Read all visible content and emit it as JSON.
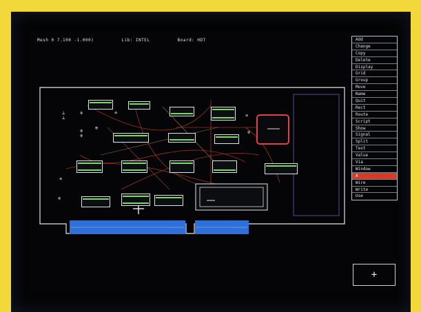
{
  "status": {
    "mesh": "Mesh 0 7.100 -1.000)",
    "lib": "Lib: INTEL",
    "board": "Board: HDT"
  },
  "menu": {
    "items": [
      {
        "label": "Add",
        "active": false
      },
      {
        "label": "Change",
        "active": false
      },
      {
        "label": "Copy",
        "active": false
      },
      {
        "label": "Delete",
        "active": false
      },
      {
        "label": "Display",
        "active": false
      },
      {
        "label": "Grid",
        "active": false
      },
      {
        "label": "Group",
        "active": false
      },
      {
        "label": "Move",
        "active": false
      },
      {
        "label": "Name",
        "active": false
      },
      {
        "label": "Quit",
        "active": false
      },
      {
        "label": "Rect",
        "active": false
      },
      {
        "label": "Route",
        "active": false
      },
      {
        "label": "Script",
        "active": false
      },
      {
        "label": "Show",
        "active": false
      },
      {
        "label": "Signal",
        "active": false
      },
      {
        "label": "Split",
        "active": false
      },
      {
        "label": "Text",
        "active": false
      },
      {
        "label": "Value",
        "active": false
      },
      {
        "label": "Via",
        "active": false
      },
      {
        "label": "Window",
        "active": false
      },
      {
        "label": "A",
        "active": true
      },
      {
        "label": "Wire",
        "active": false
      },
      {
        "label": "Write",
        "active": false
      },
      {
        "label": "Use",
        "active": false
      }
    ]
  },
  "cursor_symbol": "+",
  "plus_button_symbol": "+",
  "colors": {
    "board_outline": "#e3e6ea",
    "edge_connector": "#2f6fd8",
    "active_menu": "#d83a26",
    "chip_pins": "#7fd96a",
    "trace": "#c0392b"
  },
  "icons": [
    "board-outline",
    "ic-chip",
    "capacitor-symbol",
    "crosshair-cursor",
    "plus-icon"
  ]
}
